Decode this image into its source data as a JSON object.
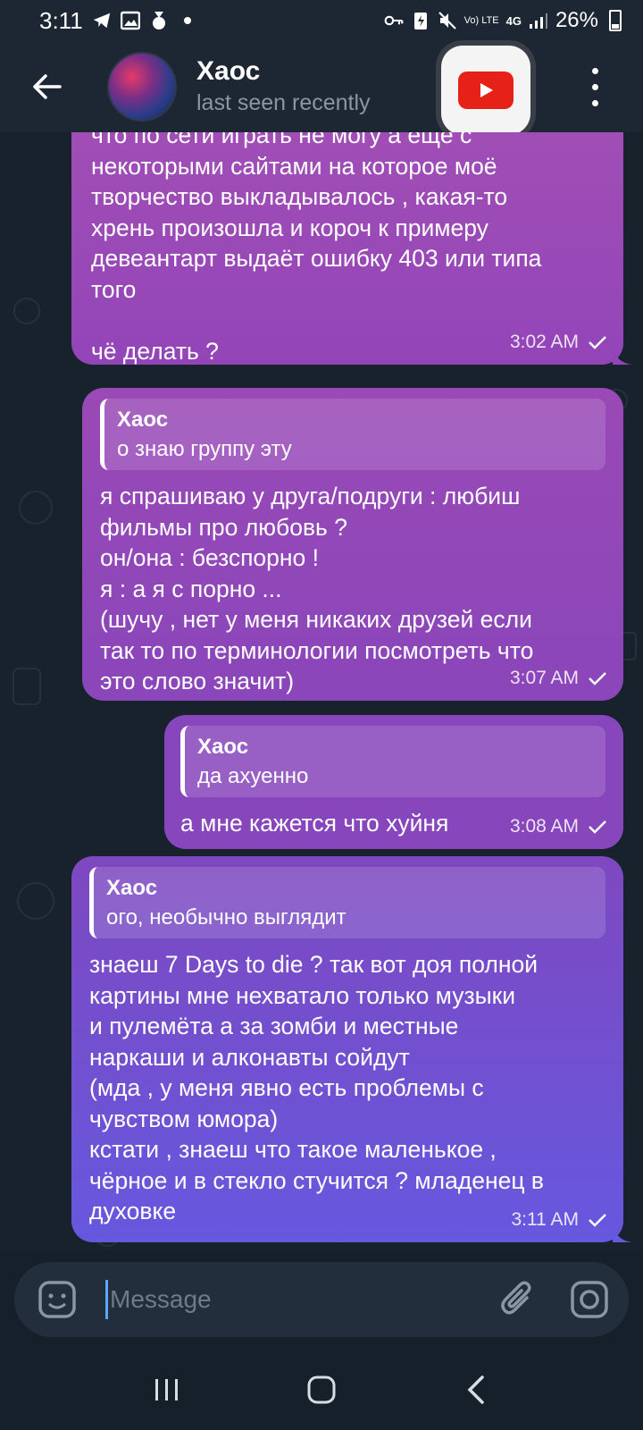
{
  "status_bar": {
    "time": "3:11",
    "battery": "26%",
    "network": "4G",
    "volte": "Vo) LTE"
  },
  "header": {
    "title": "Хаос",
    "subtitle": "last seen recently"
  },
  "messages": [
    {
      "text": "что по сети играть не могу а ещё с\nнекоторыми сайтами на которое моё\nтворчество выкладывалось , какая-то\nхрень произошла и короч к примеру\nдевеантарт выдаёт ошибку 403 или типа\nтого\n\nчё делать ?",
      "time": "3:02 AM",
      "status": "sent"
    },
    {
      "reply_name": "Хаос",
      "reply_text": "о знаю группу эту",
      "text": "я спрашиваю у друга/подруги : любиш\nфильмы про любовь ?\nон/она : безспорно !\nя : а я с порно ...\n(шучу , нет у меня никаких друзей если\nтак то по терминологии посмотреть что\nэто слово значит)",
      "time": "3:07 AM",
      "status": "sent"
    },
    {
      "reply_name": "Хаос",
      "reply_text": "да ахуенно",
      "text": "а мне кажется что хуйня",
      "time": "3:08 AM",
      "status": "sent"
    },
    {
      "reply_name": "Хаос",
      "reply_text": "ого, необычно выглядит",
      "text": "знаеш 7 Days to die ? так вот доя полной\nкартины мне нехватало только музыки\nи пулемёта а за зомби и местные\nнаркаши и алконавты сойдут\n(мда , у меня явно есть проблемы с\nчувством юмора)\nкстати , знаеш что такое маленькое ,\nчёрное и в стекло стучится ? младенец в\nдуховке",
      "time": "3:11 AM",
      "status": "sent"
    }
  ],
  "input": {
    "placeholder": "Message",
    "value": ""
  },
  "colors": {
    "bubble_top": "#a24fb5",
    "bubble_bottom": "#6658df",
    "background": "#18222d",
    "header": "#1d2733"
  },
  "icons": [
    "back-arrow-icon",
    "more-vert-icon",
    "youtube-icon",
    "emoji-icon",
    "attach-icon",
    "camera-icon",
    "check-icon",
    "recents-icon",
    "home-icon",
    "nav-back-icon"
  ]
}
